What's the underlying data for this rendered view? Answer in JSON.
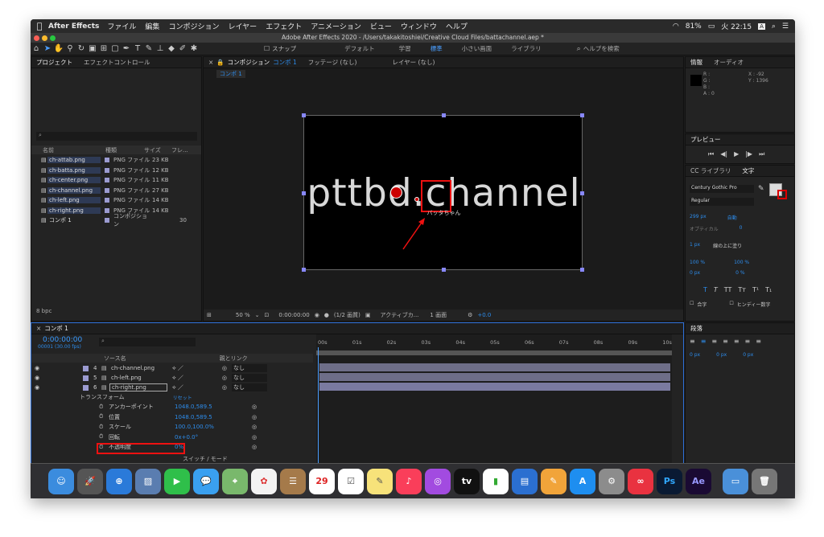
{
  "menubar": {
    "app": "After Effects",
    "items": [
      "ファイル",
      "編集",
      "コンポジション",
      "レイヤー",
      "エフェクト",
      "アニメーション",
      "ビュー",
      "ウィンドウ",
      "ヘルプ"
    ],
    "battery": "81%",
    "clock": "火 22:15",
    "input": "A"
  },
  "window": {
    "title": "Adobe After Effects 2020 - /Users/takakitoshiei/Creative Cloud Files/battachannel.aep *"
  },
  "toolbar": {
    "snap": "スナップ",
    "workspaces": [
      "デフォルト",
      "学習",
      "標準",
      "小さい画面",
      "ライブラリ"
    ],
    "help_search": "ヘルプを検索"
  },
  "project": {
    "tab": "プロジェクト",
    "tab2": "エフェクトコントロール",
    "headers": [
      "名前",
      "種類",
      "サイズ",
      "フレ..."
    ],
    "items": [
      {
        "name": "ch-attab.png",
        "type": "PNG ファイル",
        "size": "23 KB"
      },
      {
        "name": "ch-batta.png",
        "type": "PNG ファイル",
        "size": "12 KB"
      },
      {
        "name": "ch-center.png",
        "type": "PNG ファイル",
        "size": "11 KB"
      },
      {
        "name": "ch-channel.png",
        "type": "PNG ファイル",
        "size": "27 KB"
      },
      {
        "name": "ch-left.png",
        "type": "PNG ファイル",
        "size": "14 KB"
      },
      {
        "name": "ch-right.png",
        "type": "PNG ファイル",
        "size": "14 KB"
      },
      {
        "name": "コンポ 1",
        "type": "コンポジション",
        "size": "",
        "frames": "30"
      }
    ],
    "bpc": "8 bpc"
  },
  "comp": {
    "tab": "コンポジション",
    "tab_name": "コンポ 1",
    "footage": "フッテージ (なし)",
    "layer": "レイヤー (なし)",
    "crumb": "コンポ 1",
    "logo": "pttbd.channel",
    "caption": "バッタちゃん",
    "zoom": "50 %",
    "timecode": "0:00:00:00",
    "quality": "(1/2 画質)",
    "camera": "アクティブカ...",
    "views": "1 画面",
    "exposure": "+0.0"
  },
  "info": {
    "tab": "情報",
    "tab2": "オーディオ",
    "r": "R :",
    "g": "G :",
    "b": "B :",
    "a": "A : 0",
    "x": "X : -92",
    "y": "Y : 1396"
  },
  "preview": {
    "tab": "プレビュー"
  },
  "character": {
    "tab1": "CC ライブラリ",
    "tab2": "文字",
    "font": "Century Gothic Pro",
    "style": "Regular",
    "size": "299 px",
    "leading": "自動",
    "tracking": "0",
    "kerning": "オプティカル",
    "stroke": "1 px",
    "stroke_type": "線の上に塗り",
    "vscale": "100 %",
    "hscale": "100 %",
    "baseline": "0 px",
    "tsume": "0 %",
    "ligature": "合字",
    "hindi": "ヒンディー数字"
  },
  "paragraph": {
    "tab": "段落",
    "indent": "0 px"
  },
  "timeline": {
    "tab": "コンポ 1",
    "timecode": "0:00:00:00",
    "fps": "00001 (30.00 fps)",
    "col_source": "ソース名",
    "col_parent": "親とリンク",
    "layers": [
      {
        "num": "4",
        "name": "ch-channel.png",
        "parent": "なし"
      },
      {
        "num": "5",
        "name": "ch-left.png",
        "parent": "なし"
      },
      {
        "num": "6",
        "name": "ch-right.png",
        "parent": "なし"
      }
    ],
    "transform": "トランスフォーム",
    "reset": "リセット",
    "props": [
      {
        "name": "アンカーポイント",
        "value": "1048.0,589.5"
      },
      {
        "name": "位置",
        "value": "1048.0,589.5"
      },
      {
        "name": "スケール",
        "value": "100.0,100.0%"
      },
      {
        "name": "回転",
        "value": "0x+0.0°"
      },
      {
        "name": "不透明度",
        "value": "0%"
      }
    ],
    "switch_mode": "スイッチ / モード",
    "ruler": [
      "00s",
      "01s",
      "02s",
      "03s",
      "04s",
      "05s",
      "06s",
      "07s",
      "08s",
      "09s",
      "10s"
    ]
  }
}
